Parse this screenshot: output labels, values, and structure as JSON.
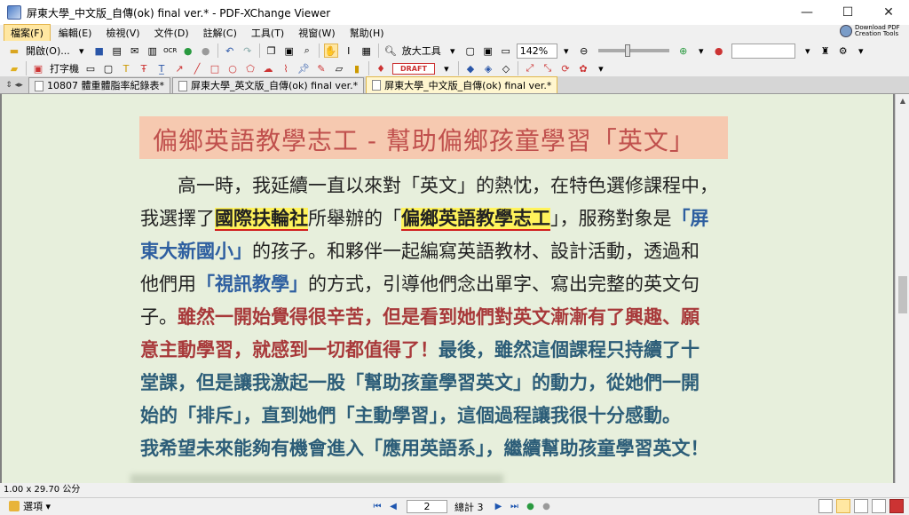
{
  "window": {
    "title": "屏東大學_中文版_自傳(ok) final ver.* - PDF-XChange Viewer",
    "minimize": "—",
    "maximize": "☐",
    "close": "✕"
  },
  "menu": {
    "items": [
      "檔案(F)",
      "編輯(E)",
      "檢視(V)",
      "文件(D)",
      "註解(C)",
      "工具(T)",
      "視窗(W)",
      "幫助(H)"
    ],
    "download_line1": "Download PDF",
    "download_line2": "Creation Tools"
  },
  "toolbar": {
    "open_label": "開啟(O)...",
    "zoom_tool_label": "放大工具",
    "zoom_value": "142%",
    "typewriter_label": "打字機",
    "draft_stamp": "DRAFT"
  },
  "tabs": [
    {
      "label": "10807 體重體脂率紀錄表*"
    },
    {
      "label": "屏東大學_英文版_自傳(ok) final ver.*"
    },
    {
      "label": "屏東大學_中文版_自傳(ok) final ver.*"
    }
  ],
  "document": {
    "heading": "偏鄉英語教學志工 - 幫助偏鄉孩童學習「英文」",
    "line1": "　　高一時，我延續一直以來對「英文」的熱忱，在特色選修課程中，",
    "line2_a": "我選擇了",
    "line2_hl1": "國際扶輪社",
    "line2_b": "所舉辦的「",
    "line2_hl2": "偏鄉英語教學志工",
    "line2_c": "」，服務對象是",
    "line2_d": "「屏",
    "line3_a": "東大新國小」",
    "line3_b": "的孩子。和夥伴一起編寫英語教材、設計活動，透過和",
    "line4_a": "他們用",
    "line4_b": "「視訊教學」",
    "line4_c": "的方式，引導他們念出單字、寫出完整的英文句",
    "line5_a": "子。",
    "line5_b": "雖然一開始覺得很辛苦，但是看到她們對英文漸漸有了興趣、願",
    "line6_a": "意主動學習，就感到一切都值得了！",
    "line6_b": "最後，雖然這個課程只持續了十",
    "line7": "堂課，但是讓我激起一股「幫助孩童學習英文」的動力，從她們一開",
    "line8": "始的「排斥」，直到她們「主動學習」，這個過程讓我很十分感動。",
    "line9": "我希望未來能夠有機會進入「應用英語系」，繼續幫助孩童學習英文！"
  },
  "status": {
    "page_size": "1.00 x 29.70 公分",
    "options_label": "選項",
    "current_page": "2",
    "page_total": "總計 3"
  },
  "colors": {
    "page_background": "#e7efdc",
    "heading_box": "#f6c9b0",
    "heading_text": "#c0504d",
    "highlight": "#fff35c",
    "blue_text": "#2e5fa0",
    "red_text": "#a8393a",
    "teal_text": "#2c5d78"
  }
}
